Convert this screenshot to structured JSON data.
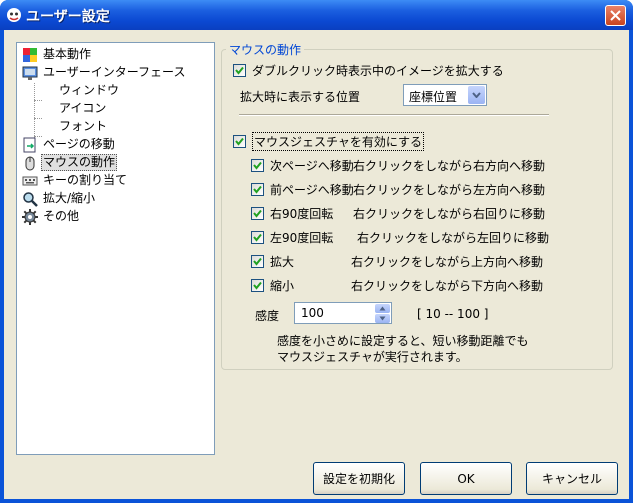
{
  "window": {
    "title": "ユーザー設定"
  },
  "tree": {
    "items": [
      {
        "label": "基本動作"
      },
      {
        "label": "ユーザーインターフェース"
      },
      {
        "label": "ウィンドウ"
      },
      {
        "label": "アイコン"
      },
      {
        "label": "フォント"
      },
      {
        "label": "ページの移動"
      },
      {
        "label": "マウスの動作"
      },
      {
        "label": "キーの割り当て"
      },
      {
        "label": "拡大/縮小"
      },
      {
        "label": "その他"
      }
    ]
  },
  "mouse": {
    "group_title": "マウスの動作",
    "dblclick_label": "ダブルクリック時表示中のイメージを拡大する",
    "dblclick_checked": true,
    "position_label": "拡大時に表示する位置",
    "position_value": "座標位置",
    "gesture_label": "マウスジェスチャを有効にする",
    "gesture_checked": true,
    "gestures": [
      {
        "name": "次ページへ移動",
        "desc": "右クリックをしながら右方向へ移動",
        "checked": true
      },
      {
        "name": "前ページへ移動",
        "desc": "右クリックをしながら左方向へ移動",
        "checked": true
      },
      {
        "name": "右90度回転",
        "desc": "右クリックをしながら右回りに移動",
        "checked": true
      },
      {
        "name": "左90度回転",
        "desc": "右クリックをしながら左回りに移動",
        "checked": true
      },
      {
        "name": "拡大",
        "desc": "右クリックをしながら上方向へ移動",
        "checked": true
      },
      {
        "name": "縮小",
        "desc": "右クリックをしながら下方向へ移動",
        "checked": true
      }
    ],
    "sensitivity_label": "感度",
    "sensitivity_value": "100",
    "sensitivity_range": "[ 10 -- 100 ]",
    "note_line1": "感度を小さめに設定すると、短い移動距離でも",
    "note_line2": "マウスジェスチャが実行されます。"
  },
  "buttons": {
    "reset": "設定を初期化",
    "ok": "OK",
    "cancel": "キャンセル"
  },
  "colors": {
    "titlebar": "#0b49d2",
    "group_title": "#0046d5",
    "client_bg": "#ece9d8"
  }
}
